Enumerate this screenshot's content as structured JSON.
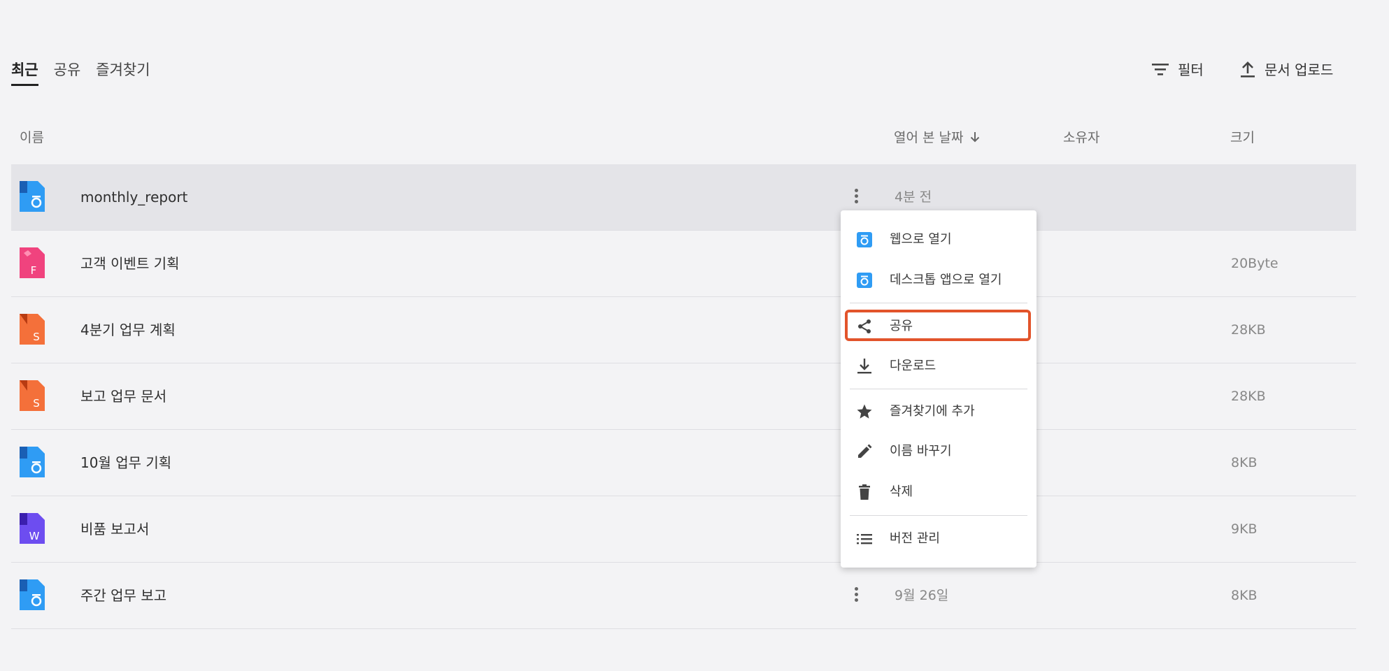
{
  "tabs": [
    {
      "label": "최근",
      "active": true
    },
    {
      "label": "공유",
      "active": false
    },
    {
      "label": "즐겨찾기",
      "active": false
    }
  ],
  "toolbar": {
    "filter_label": "필터",
    "upload_label": "문서 업로드"
  },
  "columns": {
    "name": "이름",
    "opened_date": "열어 본 날짜",
    "owner": "소유자",
    "size": "크기"
  },
  "files": [
    {
      "name": "monthly_report",
      "date": "4분 전",
      "size": "",
      "icon": "docs-blue-icon",
      "selected": true
    },
    {
      "name": "고객 이벤트 기획",
      "date": "",
      "size": "20Byte",
      "icon": "form-pink-icon"
    },
    {
      "name": "4분기 업무 계획",
      "date": "",
      "size": "28KB",
      "icon": "slides-orange-icon"
    },
    {
      "name": "보고 업무 문서",
      "date": "",
      "size": "28KB",
      "icon": "slides-orange-icon"
    },
    {
      "name": "10월 업무 기획",
      "date": "",
      "size": "8KB",
      "icon": "docs-blue-icon"
    },
    {
      "name": "비품 보고서",
      "date": "",
      "size": "9KB",
      "icon": "word-purple-icon"
    },
    {
      "name": "주간 업무 보고",
      "date": "9월 26일",
      "size": "8KB",
      "icon": "docs-blue-icon"
    }
  ],
  "menu": {
    "open_web": "웹으로 열기",
    "open_desktop": "데스크톱 앱으로 열기",
    "share": "공유",
    "download": "다운로드",
    "add_favorite": "즐겨찾기에 추가",
    "rename": "이름 바꾸기",
    "delete": "삭제",
    "version": "버전 관리"
  },
  "colors": {
    "highlight": "#e2542b",
    "docs_blue": "#2f9cf4",
    "form_pink": "#f0437e",
    "slides_orange": "#f4703a",
    "word_purple": "#6d4df0"
  }
}
